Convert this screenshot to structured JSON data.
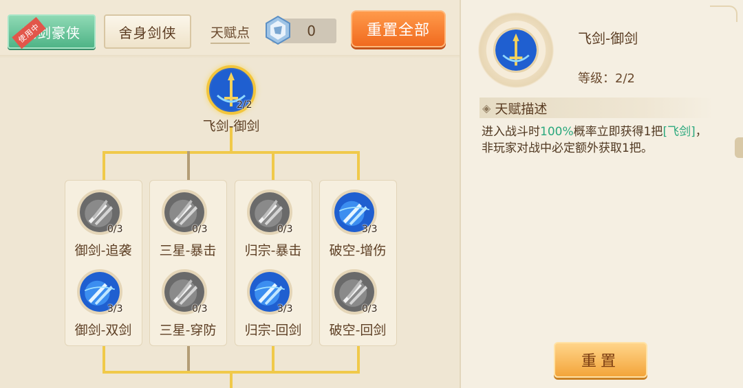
{
  "tabs": {
    "tab1_label": "飞剑豪侠",
    "tab1_badge": "使用中",
    "tab2_label": "舍身剑侠"
  },
  "talent_points": {
    "label": "天赋点",
    "value": "0"
  },
  "reset_all_label": "重置全部",
  "root": {
    "name": "飞剑-御剑",
    "count": "2/2",
    "icon": "flying-sword-icon"
  },
  "columns": [
    {
      "top": {
        "name": "御剑-追袭",
        "count": "0/3",
        "active": false
      },
      "bottom": {
        "name": "御剑-双剑",
        "count": "3/3",
        "active": true
      }
    },
    {
      "top": {
        "name": "三星-暴击",
        "count": "0/3",
        "active": false
      },
      "bottom": {
        "name": "三星-穿防",
        "count": "0/3",
        "active": false
      }
    },
    {
      "top": {
        "name": "归宗-暴击",
        "count": "0/3",
        "active": false
      },
      "bottom": {
        "name": "归宗-回剑",
        "count": "3/3",
        "active": true
      }
    },
    {
      "top": {
        "name": "破空-增伤",
        "count": "3/3",
        "active": true
      },
      "bottom": {
        "name": "破空-回剑",
        "count": "0/3",
        "active": false
      }
    }
  ],
  "detail": {
    "title": "飞剑-御剑",
    "level_label": "等级：2/2",
    "desc_heading": "天赋描述",
    "desc_part1": "进入战斗时",
    "desc_hl1": "100%",
    "desc_part2": "概率立即获得1把",
    "desc_hl2": "[飞剑]",
    "desc_part3": "，非玩家对战中必定额外获取1把。",
    "reset_label": "重置"
  },
  "colors": {
    "accent_green": "#2aa87d",
    "tab_active": "#4fb487",
    "reset_orange": "#f06a1f",
    "line_gold": "#f0c94a"
  }
}
